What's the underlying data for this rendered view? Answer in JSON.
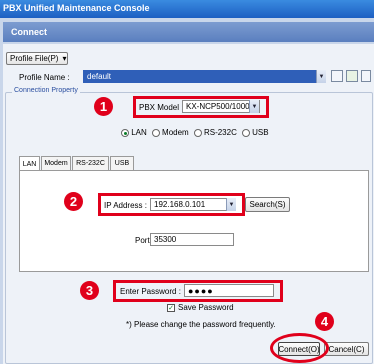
{
  "window": {
    "title": "PBX Unified Maintenance Console"
  },
  "section": {
    "title": "Connect"
  },
  "toolbar": {
    "profile_file_label": "Profile File(P)",
    "profile_file_arrow": "▾"
  },
  "profile": {
    "label": "Profile Name :",
    "value": "default"
  },
  "connection_property": {
    "legend": "Connection Property",
    "pbx_model_label": "PBX Model :",
    "pbx_model_value": "KX-NCP500/1000",
    "types": [
      {
        "label": "LAN",
        "selected": true
      },
      {
        "label": "Modem",
        "selected": false
      },
      {
        "label": "RS-232C",
        "selected": false
      },
      {
        "label": "USB",
        "selected": false
      }
    ]
  },
  "tabs": [
    "LAN",
    "Modem",
    "RS-232C",
    "USB"
  ],
  "lan": {
    "ip_label": "IP Address :",
    "ip_value": "192.168.0.101",
    "search_label": "Search(S)",
    "port_label": "Port :",
    "port_value": "35300"
  },
  "password": {
    "label": "Enter Password :",
    "value": "●●●●",
    "save_label": "Save Password",
    "save_checked": true,
    "note": "*) Please change the password frequently."
  },
  "footer": {
    "connect_label": "Connect(O)",
    "cancel_label": "Cancel(C)"
  },
  "badges": [
    "1",
    "2",
    "3",
    "4"
  ],
  "colors": {
    "highlight": "#e0001b",
    "title_bar": "#1d5fc2",
    "section_header": "#5a7fbf"
  }
}
